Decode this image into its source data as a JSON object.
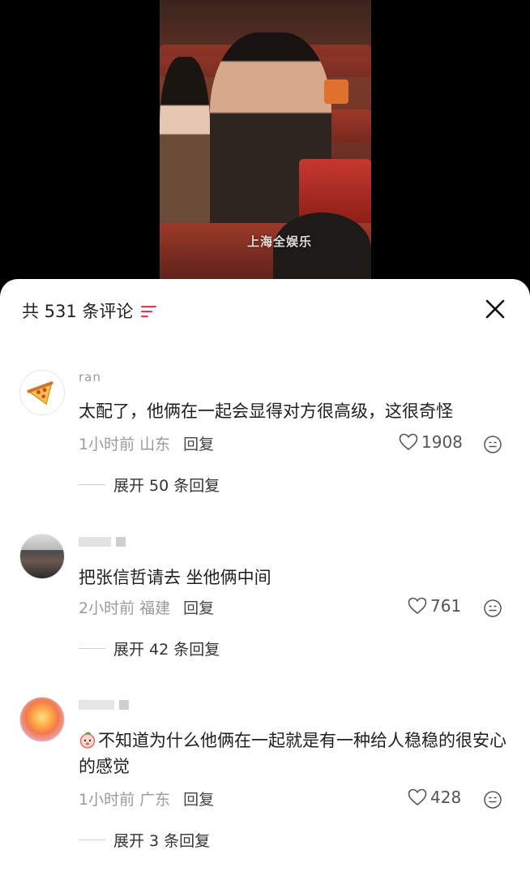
{
  "video": {
    "watermark": "上海全娱乐"
  },
  "sheet": {
    "title": "共 531 条评论",
    "sort_icon": "filter-lines-icon",
    "close_icon": "close-icon",
    "accent_color": "#ff2e4d"
  },
  "comments": [
    {
      "username": "ran",
      "avatar": "pizza-avatar",
      "text": "太配了，他俩在一起会显得对方很高级，这很奇怪",
      "time": "1小时前",
      "location": "山东",
      "reply_label": "回复",
      "likes": "1908",
      "expand_label": "展开 50 条回复"
    },
    {
      "username": "",
      "avatar": "photo-avatar",
      "text": "把张信哲请去  坐他俩中间",
      "time": "2小时前",
      "location": "福建",
      "reply_label": "回复",
      "likes": "761",
      "expand_label": "展开 42 条回复"
    },
    {
      "username": "",
      "avatar": "sunset-avatar",
      "text": "不知道为什么他俩在一起就是有一种给人稳稳的很安心的感觉",
      "time": "1小时前",
      "location": "广东",
      "reply_label": "回复",
      "likes": "428",
      "expand_label": "展开 3 条回复"
    }
  ]
}
